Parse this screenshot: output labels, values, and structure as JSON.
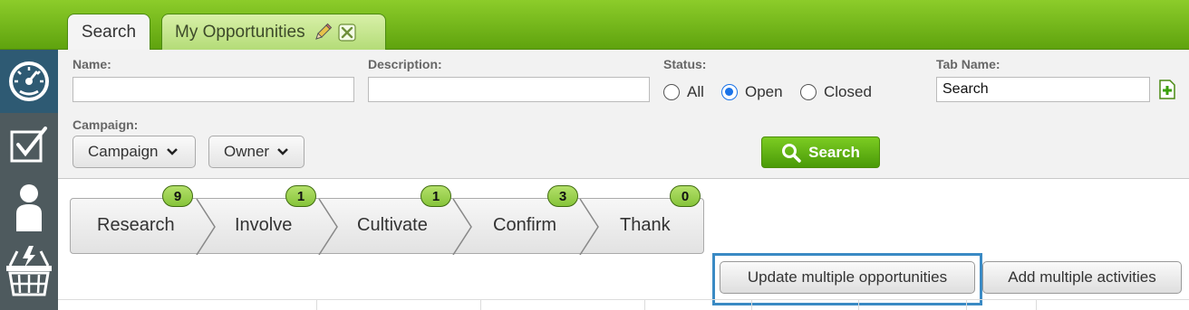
{
  "tabs": [
    {
      "label": "Search",
      "active": true
    },
    {
      "label": "My Opportunities",
      "active": false
    }
  ],
  "nav": {
    "items": [
      "dashboard-icon",
      "tasks-checkbox-icon",
      "person-icon",
      "basket-icon"
    ],
    "active": "dashboard-icon"
  },
  "filters": {
    "name_label": "Name:",
    "name_value": "",
    "description_label": "Description:",
    "description_value": "",
    "status_label": "Status:",
    "status_options": [
      "All",
      "Open",
      "Closed"
    ],
    "status_selected": "Open",
    "tabname_label": "Tab Name:",
    "tabname_value": "Search",
    "campaign_label": "Campaign:",
    "campaign_dropdown": "Campaign",
    "owner_dropdown": "Owner",
    "search_button": "Search"
  },
  "pipeline": {
    "stages": [
      {
        "label": "Research",
        "count": "9"
      },
      {
        "label": "Involve",
        "count": "1"
      },
      {
        "label": "Cultivate",
        "count": "1"
      },
      {
        "label": "Confirm",
        "count": "3"
      },
      {
        "label": "Thank",
        "count": "0"
      }
    ]
  },
  "actions": {
    "update_multiple": "Update multiple opportunities",
    "add_multiple": "Add multiple activities"
  },
  "colors": {
    "brand_green": "#6cb318",
    "nav_bg": "#4e5a5e",
    "nav_active": "#2e5a73",
    "highlight_blue": "#3a8ac4"
  }
}
